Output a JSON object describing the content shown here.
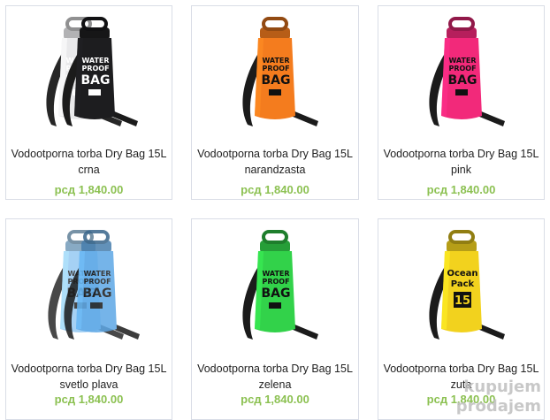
{
  "products": [
    {
      "title_line1": "Vodootporna torba Dry Bag 15L",
      "title_line2": "crna",
      "price": "рсд 1,840.00",
      "bag_color": "#1d1d1f",
      "print_line1": "WATER",
      "print_line2": "PROOF",
      "print_line3": "BAG",
      "print_color": "#ffffff"
    },
    {
      "title_line1": "Vodootporna torba Dry Bag 15L",
      "title_line2": "narandzasta",
      "price": "рсд 1,840.00",
      "bag_color": "#f47c1e",
      "print_line1": "WATER",
      "print_line2": "PROOF",
      "print_line3": "BAG",
      "print_color": "#111111"
    },
    {
      "title_line1": "Vodootporna torba Dry Bag 15L",
      "title_line2": "pink",
      "price": "рсд 1,840.00",
      "bag_color": "#f2297a",
      "print_line1": "WATER",
      "print_line2": "PROOF",
      "print_line3": "BAG",
      "print_color": "#111111"
    },
    {
      "title_line1": "Vodootporna torba Dry Bag 15L",
      "title_line2": "svetlo plava",
      "price": "рсд 1,840.00",
      "bag_color": "#5ea8e6",
      "print_line1": "WATER",
      "print_line2": "PROOF",
      "print_line3": "BAG",
      "print_color": "#1a1a1a"
    },
    {
      "title_line1": "Vodootporna torba Dry Bag 15L",
      "title_line2": "zelena",
      "price": "рсд 1,840.00",
      "bag_color": "#32d24a",
      "print_line1": "WATER",
      "print_line2": "PROOF",
      "print_line3": "BAG",
      "print_color": "#111111"
    },
    {
      "title_line1": "Vodootporna torba Dry Bag 15L",
      "title_line2": "zuta",
      "price": "рсд 1,840.00",
      "bag_color": "#f2d21e",
      "print_line1": "Ocean",
      "print_line2": "Pack",
      "print_line3": "15",
      "print_color": "#111111"
    }
  ],
  "watermark": {
    "line1": "kupujem",
    "line2": "prodajem"
  }
}
